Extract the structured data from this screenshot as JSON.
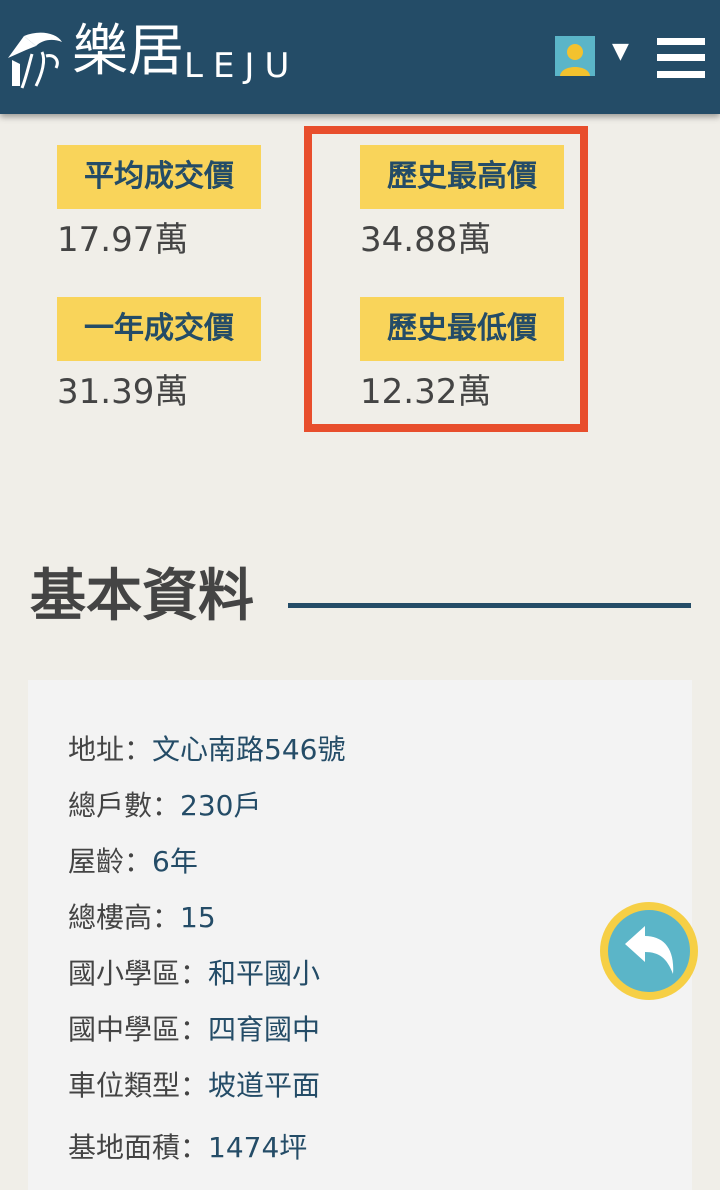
{
  "header": {
    "logo_cn": "樂居",
    "logo_en": "LEJU",
    "caret": "▼"
  },
  "prices": {
    "average": {
      "label": "平均成交價",
      "value": "17.97萬"
    },
    "one_year": {
      "label": "一年成交價",
      "value": "31.39萬"
    },
    "highest": {
      "label": "歷史最高價",
      "value": "34.88萬"
    },
    "lowest": {
      "label": "歷史最低價",
      "value": "12.32萬"
    }
  },
  "basic_info": {
    "title": "基本資料",
    "rows": [
      {
        "key": "地址：",
        "value": "文心南路546號"
      },
      {
        "key": "總戶數：",
        "value": "230戶"
      },
      {
        "key": "屋齡：",
        "value": "6年"
      },
      {
        "key": "總樓高：",
        "value": "15"
      },
      {
        "key": "國小學區：",
        "value": "和平國小"
      },
      {
        "key": "國中學區：",
        "value": "四育國中"
      },
      {
        "key": "車位類型：",
        "value": "坡道平面"
      },
      {
        "key": "基地面積：",
        "value": "1474坪"
      }
    ]
  },
  "colors": {
    "header_bg": "#244c67",
    "label_bg": "#f9d45a",
    "highlight_border": "#e84e2c",
    "back_button_fill": "#5bb5c8",
    "back_button_ring": "#f6cf45"
  },
  "icons": {
    "logo": "leju-logo-icon",
    "avatar": "user-avatar-icon",
    "menu": "hamburger-menu-icon",
    "back": "back-arrow-icon"
  }
}
